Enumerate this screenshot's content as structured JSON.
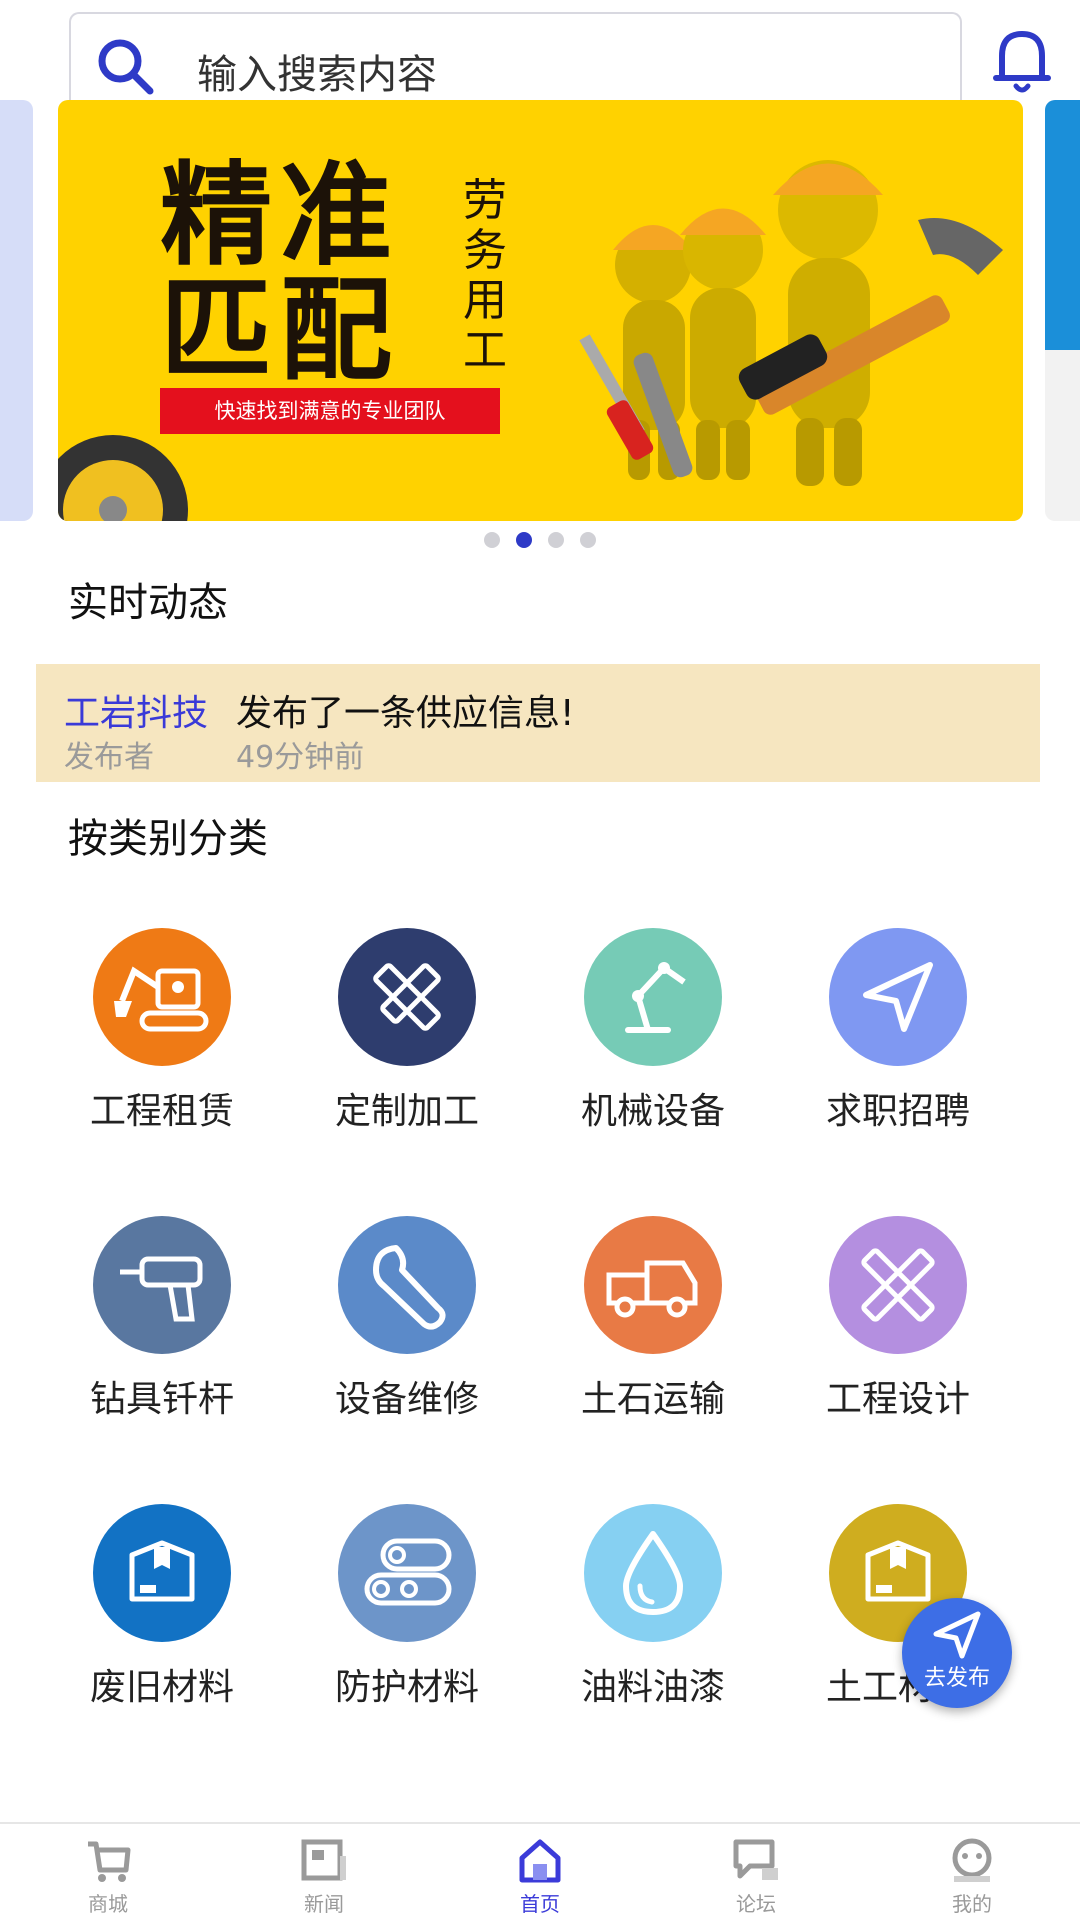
{
  "search": {
    "placeholder": "输入搜索内容"
  },
  "colors": {
    "accent": "#2e3ac7",
    "banner_bg": "#ffd200",
    "news_bg": "#f6e6c0",
    "fab": "#3d6ee6"
  },
  "banner": {
    "line1": "精准",
    "line2": "匹配",
    "vertical": "劳务用工",
    "tagline": "快速找到满意的专业团队",
    "pager_total": 4,
    "pager_active_index": 2
  },
  "realtime": {
    "title": "实时动态",
    "item": {
      "publisher": "工岩抖技",
      "role": "发布者",
      "message": "发布了一条供应信息!",
      "time": "49分钟前"
    }
  },
  "categories": {
    "title": "按类别分类",
    "items": [
      {
        "label": "工程租赁",
        "icon": "excavator-icon",
        "color": "#ef7a15"
      },
      {
        "label": "定制加工",
        "icon": "ruler-pencil-icon",
        "color": "#2e3d6e"
      },
      {
        "label": "机械设备",
        "icon": "robot-arm-icon",
        "color": "#76cbb6"
      },
      {
        "label": "求职招聘",
        "icon": "paper-plane-icon",
        "color": "#7f98f2"
      },
      {
        "label": "钻具钎杆",
        "icon": "drill-icon",
        "color": "#5977a0"
      },
      {
        "label": "设备维修",
        "icon": "wrench-icon",
        "color": "#5b8ac9"
      },
      {
        "label": "土石运输",
        "icon": "truck-icon",
        "color": "#e87a45"
      },
      {
        "label": "工程设计",
        "icon": "pencils-crossed-icon",
        "color": "#b48fe0"
      },
      {
        "label": "废旧材料",
        "icon": "box-icon",
        "color": "#1272c4"
      },
      {
        "label": "防护材料",
        "icon": "pipes-icon",
        "color": "#6d95c9"
      },
      {
        "label": "油料油漆",
        "icon": "droplet-icon",
        "color": "#86d0f2"
      },
      {
        "label": "土工材料",
        "icon": "box-icon",
        "color": "#cfad1f"
      }
    ]
  },
  "fab": {
    "label": "去发布",
    "icon": "paper-plane-icon"
  },
  "tabbar": {
    "items": [
      {
        "label": "商城",
        "icon": "cart-icon",
        "active": false
      },
      {
        "label": "新闻",
        "icon": "news-icon",
        "active": false
      },
      {
        "label": "首页",
        "icon": "home-icon",
        "active": true
      },
      {
        "label": "论坛",
        "icon": "chat-icon",
        "active": false
      },
      {
        "label": "我的",
        "icon": "profile-icon",
        "active": false
      }
    ]
  }
}
